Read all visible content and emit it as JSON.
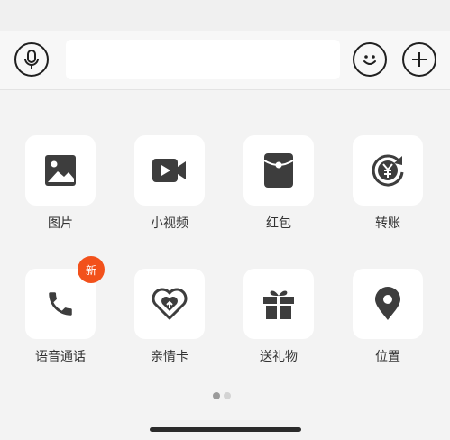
{
  "input": {
    "value": "",
    "placeholder": ""
  },
  "colors": {
    "icon": "#3d3d3d",
    "badge": "#f2511b",
    "dot_active": "#9a9a9a",
    "dot_inactive": "#d3d3d3"
  },
  "panel": {
    "items": [
      {
        "label": "图片",
        "icon": "image-icon"
      },
      {
        "label": "小视频",
        "icon": "video-icon"
      },
      {
        "label": "红包",
        "icon": "red-packet-icon"
      },
      {
        "label": "转账",
        "icon": "transfer-icon"
      },
      {
        "label": "语音通话",
        "icon": "phone-icon",
        "badge": "新"
      },
      {
        "label": "亲情卡",
        "icon": "family-card-icon"
      },
      {
        "label": "送礼物",
        "icon": "gift-icon"
      },
      {
        "label": "位置",
        "icon": "location-icon"
      }
    ],
    "pages": {
      "current": 1,
      "total": 2
    }
  }
}
